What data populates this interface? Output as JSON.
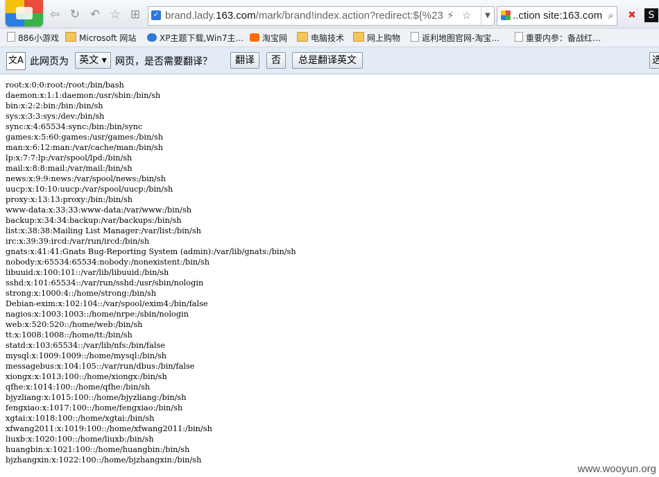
{
  "browser": {
    "url_prefix": "brand.lady.",
    "url_domain": "163.com",
    "url_suffix": "/mark/brand!index.action?redirect:${%23a",
    "search_value": "..ction site:163.com"
  },
  "bookmarks": [
    {
      "label": "886小游戏",
      "icon": "page-icon"
    },
    {
      "label": "Microsoft 网站",
      "icon": "folder-icon"
    },
    {
      "label": "XP主题下载,Win7主…",
      "icon": "site-icon"
    },
    {
      "label": "淘宝网",
      "icon": "taobao-icon"
    },
    {
      "label": "电脑技术",
      "icon": "folder-icon"
    },
    {
      "label": "网上购物",
      "icon": "folder-icon"
    },
    {
      "label": "返利地图官网-淘宝…",
      "icon": "page-icon"
    },
    {
      "label": "重要内参：备战红…",
      "icon": "page-icon"
    }
  ],
  "translate_bar": {
    "prefix": "此网页为",
    "language": "英文",
    "suffix": "网页，是否需要翻译？",
    "translate_button": "翻译",
    "no_button": "否",
    "always_button": "总是翻译英文",
    "options_button": "选"
  },
  "content_lines": [
    "root:x:0:0:root:/root:/bin/bash",
    "daemon:x:1:1:daemon:/usr/sbin:/bin/sh",
    "bin:x:2:2:bin:/bin:/bin/sh",
    "sys:x:3:3:sys:/dev:/bin/sh",
    "sync:x:4:65534:sync:/bin:/bin/sync",
    "games:x:5:60:games:/usr/games:/bin/sh",
    "man:x:6:12:man:/var/cache/man:/bin/sh",
    "lp:x:7:7:lp:/var/spool/lpd:/bin/sh",
    "mail:x:8:8:mail:/var/mail:/bin/sh",
    "news:x:9:9:news:/var/spool/news:/bin/sh",
    "uucp:x:10:10:uucp:/var/spool/uucp:/bin/sh",
    "proxy:x:13:13:proxy:/bin:/bin/sh",
    "www-data:x:33:33:www-data:/var/www:/bin/sh",
    "backup:x:34:34:backup:/var/backups:/bin/sh",
    "list:x:38:38:Mailing List Manager:/var/list:/bin/sh",
    "irc:x:39:39:ircd:/var/run/ircd:/bin/sh",
    "gnats:x:41:41:Gnats Bug-Reporting System (admin):/var/lib/gnats:/bin/sh",
    "nobody:x:65534:65534:nobody:/nonexistent:/bin/sh",
    "libuuid:x:100:101::/var/lib/libuuid:/bin/sh",
    "sshd:x:101:65534::/var/run/sshd:/usr/sbin/nologin",
    "strong:x:1000:4::/home/strong:/bin/sh",
    "Debian-exim:x:102:104::/var/spool/exim4:/bin/false",
    "nagios:x:1003:1003::/home/nrpe:/sbin/nologin",
    "web:x:520:520::/home/web:/bin/sh",
    "tt:x:1008:1008::/home/tt:/bin/sh",
    "statd:x:103:65534::/var/lib/nfs:/bin/false",
    "mysql:x:1009:1009::/home/mysql:/bin/sh",
    "messagebus:x:104:105::/var/run/dbus:/bin/false",
    "xiongx:x:1013:100::/home/xiongx:/bin/sh",
    "qfhe:x:1014:100::/home/qfhe:/bin/sh",
    "bjyzliang:x:1015:100::/home/bjyzliang:/bin/sh",
    "fengxiao:x:1017:100::/home/fengxiao:/bin/sh",
    "xgtai:x:1018:100::/home/xgtai:/bin/sh",
    "xfwang2011:x:1019:100::/home/xfwang2011:/bin/sh",
    "liuxb:x:1020:100::/home/liuxb:/bin/sh",
    "huangbin:x:1021:100::/home/huangbin:/bin/sh",
    "bjzhangxin:x:1022:100::/home/bjzhangxin:/bin/sh"
  ],
  "watermark": "www.wooyun.org"
}
